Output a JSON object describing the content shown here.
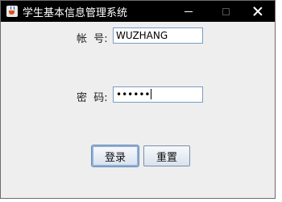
{
  "window": {
    "title": "学生基本信息管理系统"
  },
  "form": {
    "username_label": "帐  号:",
    "username_value": "WUZHANG",
    "password_label": "密  码:",
    "password_mask": "••••••"
  },
  "buttons": {
    "login_label": "登录",
    "reset_label": "重置"
  },
  "icons": {
    "app": "java-cup-icon",
    "minimize": "minimize-icon",
    "maximize": "maximize-icon",
    "close": "close-icon"
  }
}
